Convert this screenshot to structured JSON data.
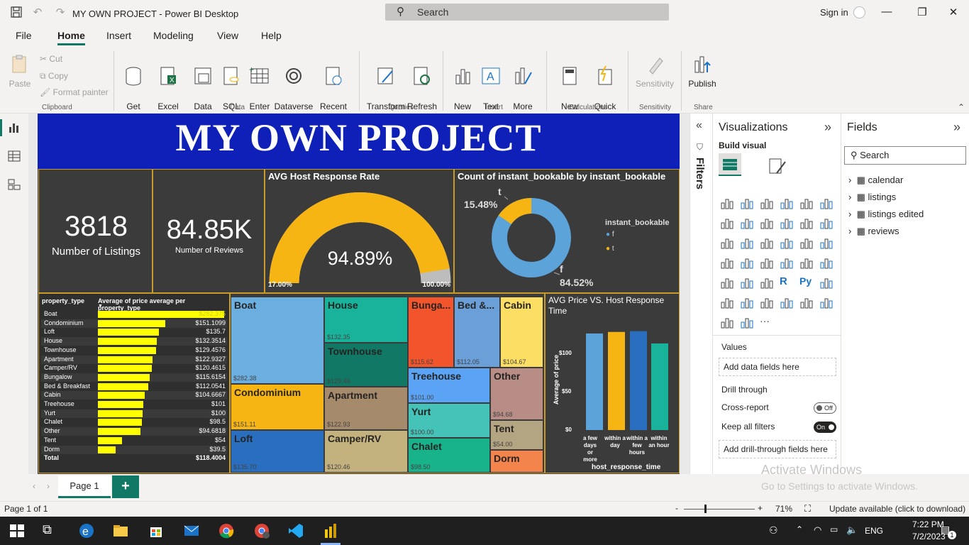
{
  "window": {
    "title": "MY OWN PROJECT - Power BI Desktop",
    "search_placeholder": "Search",
    "signin": "Sign in"
  },
  "menu_tabs": [
    "File",
    "Home",
    "Insert",
    "Modeling",
    "View",
    "Help"
  ],
  "ribbon": {
    "clipboard": {
      "paste": "Paste",
      "cut": "Cut",
      "copy": "Copy",
      "format_painter": "Format painter",
      "group": "Clipboard"
    },
    "data": {
      "get_data": "Get\ndata",
      "excel": "Excel\nworkbook",
      "data_hub": "Data\nhub",
      "sql": "SQL\nServer",
      "enter_data": "Enter\ndata",
      "dataverse": "Dataverse",
      "recent": "Recent\nsources",
      "group": "Data"
    },
    "queries": {
      "transform": "Transform\ndata",
      "refresh": "Refresh",
      "group": "Queries"
    },
    "insert": {
      "new_visual": "New\nvisual",
      "text_box": "Text\nbox",
      "more_visuals": "More\nvisuals",
      "group": "Insert"
    },
    "calculations": {
      "new_measure": "New\nmeasure",
      "quick_measure": "Quick\nmeasure",
      "group": "Calculations"
    },
    "sensitivity": {
      "label": "Sensitivity",
      "group": "Sensitivity"
    },
    "share": {
      "publish": "Publish",
      "group": "Share"
    }
  },
  "report": {
    "title": "MY OWN PROJECT",
    "cards": {
      "listings_value": "3818",
      "listings_label": "Number of Listings",
      "reviews_value": "84.85K",
      "reviews_label": "Number of Reviews"
    },
    "gauge": {
      "title": "AVG Host Response Rate",
      "value": "94.89%",
      "value_fraction": 0.9489,
      "min": "17.00%",
      "max": "100.00%",
      "color": "#f7b514"
    },
    "donut": {
      "title": "Count of instant_bookable by instant_bookable",
      "legend_title": "instant_bookable",
      "legend_items": [
        "f",
        "t"
      ],
      "t_label": "t",
      "t_pct": "15.48%",
      "f_label": "f",
      "f_pct": "84.52%",
      "colors": {
        "f": "#5ba3d9",
        "t": "#f7b514"
      }
    },
    "price_table": {
      "headers": [
        "property_type",
        "Average of price average per property_type"
      ],
      "total_label": "Total",
      "total_value": "$118.4004"
    },
    "treemap_labels": {
      "boat": "Boat",
      "house": "House",
      "bungalow": "Bunga...",
      "bnb": "Bed &...",
      "cabin": "Cabin",
      "townhouse": "Townhouse",
      "condominium": "Condominium",
      "apartment": "Apartment",
      "treehouse": "Treehouse",
      "other": "Other",
      "yurt": "Yurt",
      "loft": "Loft",
      "camper": "Camper/RV",
      "chalet": "Chalet",
      "tent": "Tent",
      "dorm": "Dorm"
    },
    "treemap_values": {
      "boat": "$282.38",
      "house": "$132.35",
      "bungalow": "$115.62",
      "bnb": "$112.05",
      "cabin": "$104.67",
      "townhouse": "$129.46",
      "condominium": "$151.11",
      "apartment": "$122.93",
      "treehouse": "$101.00",
      "other": "$94.68",
      "yurt": "$100.00",
      "loft": "$135.70",
      "camper": "$120.46",
      "chalet": "$98.50",
      "tent": "$54.00"
    },
    "column_chart": {
      "title": "AVG Price VS. Host Response Time",
      "ylabel": "Average of price",
      "xlabel": "host_response_time",
      "ticks": [
        "$100",
        "$50",
        "$0"
      ]
    }
  },
  "chart_data": [
    {
      "type": "bar",
      "title": "",
      "categories": [
        "Boat",
        "Condominium",
        "Loft",
        "House",
        "Townhouse",
        "Apartment",
        "Camper/RV",
        "Bungalow",
        "Bed & Breakfast",
        "Cabin",
        "Treehouse",
        "Yurt",
        "Chalet",
        "Other",
        "Tent",
        "Dorm"
      ],
      "values": [
        282.375,
        151.1099,
        135.7,
        132.3514,
        129.4576,
        122.9327,
        120.4615,
        115.6154,
        112.0541,
        104.6667,
        101,
        100,
        98.5,
        94.6818,
        54,
        39.5
      ],
      "labels": [
        "$282.375",
        "$151.1099",
        "$135.7",
        "$132.3514",
        "$129.4576",
        "$122.9327",
        "$120.4615",
        "$115.6154",
        "$112.0541",
        "$104.6667",
        "$101",
        "$100",
        "$98.5",
        "$94.6818",
        "$54",
        "$39.5"
      ],
      "color": "#ffff00"
    },
    {
      "type": "bar",
      "title": "AVG Price VS. Host Response Time",
      "categories": [
        "a few days or more",
        "within a day",
        "within a few hours",
        "within an hour"
      ],
      "values": [
        126,
        128,
        129,
        113
      ],
      "colors": [
        "#5ba3d9",
        "#f7b514",
        "#2a6fbf",
        "#19b39b"
      ],
      "xlabel": "host_response_time",
      "ylabel": "Average of price",
      "ylim": [
        0,
        140
      ]
    },
    {
      "type": "pie",
      "title": "Count of instant_bookable by instant_bookable",
      "categories": [
        "f",
        "t"
      ],
      "values": [
        84.52,
        15.48
      ]
    }
  ],
  "panes": {
    "filters": "Filters",
    "visualizations": "Visualizations",
    "build_visual": "Build visual",
    "values": "Values",
    "add_data_fields": "Add data fields here",
    "drill_through": "Drill through",
    "cross_report": "Cross-report",
    "cross_report_state": "Off",
    "keep_all_filters": "Keep all filters",
    "keep_all_filters_state": "On",
    "add_drill_fields": "Add drill-through fields here",
    "fields": "Fields",
    "fields_search": "Search",
    "tables": [
      "calendar",
      "listings",
      "listings edited",
      "reviews"
    ]
  },
  "pages": {
    "tab": "Page 1",
    "add": "+"
  },
  "status": {
    "page": "Page 1 of 1",
    "zoom": "71%",
    "update": "Update available (click to download)",
    "activate_title": "Activate Windows",
    "activate_sub": "Go to Settings to activate Windows."
  },
  "taskbar": {
    "lang": "ENG",
    "time": "7:22 PM",
    "date": "7/2/2023",
    "notif": "1"
  }
}
